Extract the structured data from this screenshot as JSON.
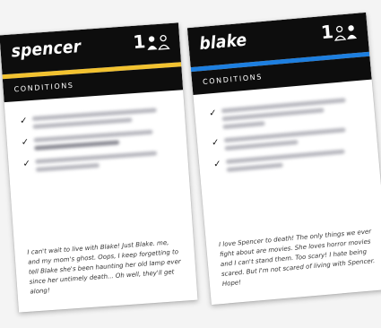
{
  "cards": [
    {
      "name": "spencer",
      "count": "1",
      "section_label": "CONDITIONS",
      "accent_color": "#f2c230",
      "icons": [
        "person-filled-icon",
        "person-outline-icon"
      ],
      "quote": "I can't wait to live with Blake! Just Blake. me, and my mom's ghost. Oops, I keep forgetting to tell Blake she's been haunting her old lamp ever since her untimely death... Oh well, they'll get along!"
    },
    {
      "name": "blake",
      "count": "1",
      "section_label": "CONDITIONS",
      "accent_color": "#1d7fe0",
      "icons": [
        "person-outline-icon",
        "person-filled-icon"
      ],
      "quote": "I love Spencer to death! The only things we ever fight about are movies. She loves horror movies and I can't stand them. Too scary! I hate being scared. But I'm not scared of living with Spencer. Hope!"
    }
  ]
}
